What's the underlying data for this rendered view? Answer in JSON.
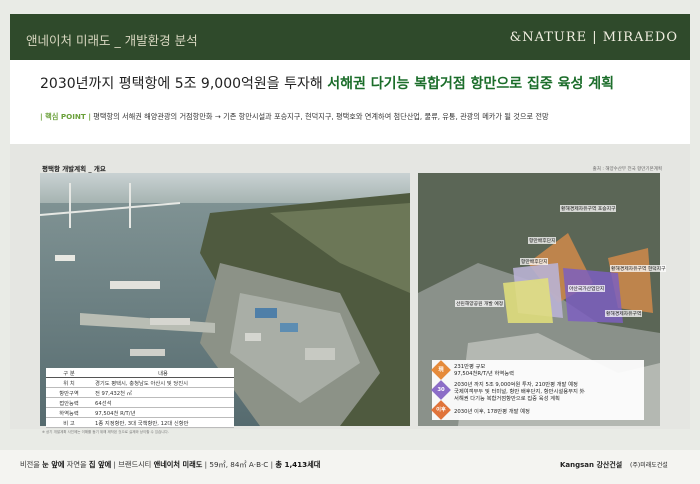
{
  "header": {
    "left_title": "앤네이처 미래도 _ 개발환경 분석",
    "right_title": "&NATURE | MIRAEDO"
  },
  "title": {
    "prefix": "2030년까지 평택항에 5조 9,000억원을 투자해 ",
    "highlight": "서해권 다기능 복합거점 항만으로 집중 육성 계획"
  },
  "point": {
    "label": "| 핵심 POINT |",
    "text": " 평택항의 서해권 해양관광의 거점항만화 → 기존 항만시설과 포승지구, 현덕지구, 평택호와 연계하여 첨단산업, 물류, 유통, 관광의 메카가 될 것으로 전망"
  },
  "left_caption": "평택항 개발계획 _ 개요",
  "source": "출처 : 해양수산부 전국 항만기본계획",
  "info_table": {
    "headers": [
      "구 분",
      "내용"
    ],
    "rows": [
      [
        "위 치",
        "경기도 평택시, 충청남도 아산시 및 당진시"
      ],
      [
        "항만구역",
        "전 97,432천 ㎡"
      ],
      [
        "접안능력",
        "64선석"
      ],
      [
        "하역능력",
        "97,504천 R/T/년"
      ],
      [
        "비 고",
        "1종 지정항만, 3대 국책항만, 12대 신항만"
      ]
    ]
  },
  "map_labels": [
    "황해경제자유구역 포승지구",
    "항만배후단지",
    "항만배후단지",
    "아산국가산업단지",
    "황해경제자유구역 현덕지구",
    "선린해양공원 개발 예정",
    "황해경제자유구역"
  ],
  "legend": [
    {
      "icon": "現",
      "color": "#e58a3a",
      "lines": [
        "231만평 규모",
        "97,504천R/T/년 하역능력"
      ]
    },
    {
      "icon": "30",
      "color": "#8b6cc7",
      "lines": [
        "2030년 까지 5조 9,000억원 투자, 210만평 개발 예정",
        "국제여객부두 및 터미널, 항만 배후단지, 항만시설용부지 外",
        "서해권 다기능 복합거점항만으로 집중 육성 계획"
      ]
    },
    {
      "icon": "이후",
      "color": "#e0733a",
      "lines": [
        "2030년 이후, 178만평 개발 예정"
      ]
    }
  ],
  "footnote": "※ 상기 개발계획 사진에는 이해를 돕기 위해 제작된 것으로 실제와 상이할 수 있습니다.",
  "footer": {
    "t1": "비전을 ",
    "b1": "눈 앞에",
    "t2": " 자연을 ",
    "b2": "집 앞에",
    "t3": " | 브랜드시티 ",
    "b3": "앤네이처 미래도",
    "t4": " | 59㎡, 84㎡ A·B·C | ",
    "b4": "총 1,413세대",
    "brand1": "Kangsan 강산건설",
    "brand2": "(주)미래도건설"
  }
}
